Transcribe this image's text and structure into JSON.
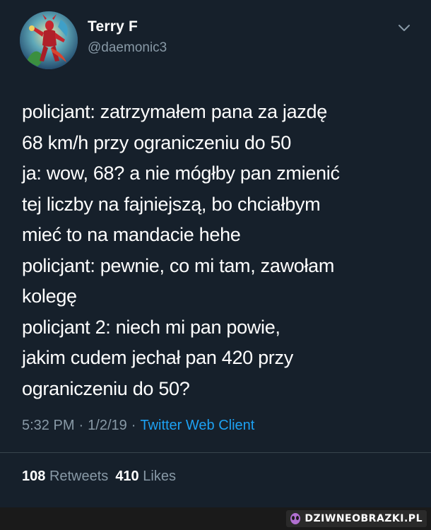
{
  "tweet": {
    "display_name": "Terry F",
    "handle": "@daemonic3",
    "text": "policjant: zatrzymałem pana za jazdę\n68 km/h przy ograniczeniu do 50\nja: wow, 68? a nie mógłby pan zmienić\ntej liczby na fajniejszą, bo chciałbym\nmieć to na mandacie hehe\npolicjant: pewnie, co mi tam, zawołam\nkolegę\npolicjant 2: niech mi pan powie,\njakim cudem jechał pan 420 przy\nograniczeniu do 50?",
    "time": "5:32 PM",
    "date": "1/2/19",
    "separator": "·",
    "client": "Twitter Web Client",
    "retweets_count": "108",
    "retweets_label": "Retweets",
    "likes_count": "410",
    "likes_label": "Likes"
  },
  "icons": {
    "avatar": "avatar-illustration",
    "more": "chevron-down-icon",
    "watermark": "alien-head-icon"
  },
  "watermark": {
    "text": "DZIWNEOBRAZKI.PL"
  },
  "colors": {
    "background": "#15202b",
    "secondary_text": "#8899a6",
    "link": "#1da1f2",
    "divider": "#38444d"
  }
}
